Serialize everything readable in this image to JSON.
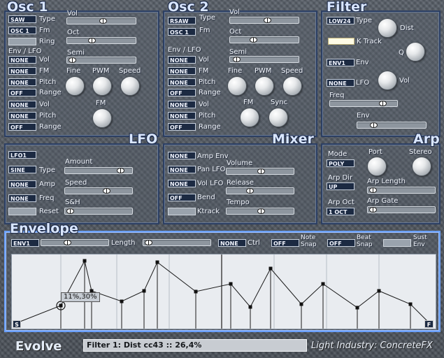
{
  "osc1": {
    "title": "Osc 1",
    "type_btn": "SAW",
    "type_lbl": "Type",
    "fm_btn": "OSC 1",
    "fm_lbl": "Fm",
    "ring_lbl": "Ring",
    "vol_lbl": "Vol",
    "oct_lbl": "Oct",
    "semi_lbl": "Semi",
    "env_lfo_lbl": "Env / LFO",
    "routes": [
      {
        "btn": "NONE",
        "lbl": "Vol"
      },
      {
        "btn": "NONE",
        "lbl": "FM"
      },
      {
        "btn": "NONE",
        "lbl": "Pitch"
      },
      {
        "btn": "OFF",
        "lbl": "Range"
      },
      {
        "btn": "NONE",
        "lbl": "Vol"
      },
      {
        "btn": "NONE",
        "lbl": "Pitch"
      },
      {
        "btn": "OFF",
        "lbl": "Range"
      }
    ],
    "fine": "Fine",
    "pwm": "PWM",
    "speed": "Speed",
    "fm": "FM"
  },
  "osc2": {
    "title": "Osc 2",
    "type_btn": "RSAW",
    "type_lbl": "Type",
    "fm_btn": "OSC 1",
    "fm_lbl": "Fm",
    "vol_lbl": "Vol",
    "oct_lbl": "Oct",
    "semi_lbl": "Semi",
    "env_lfo_lbl": "Env / LFO",
    "routes": [
      {
        "btn": "NONE",
        "lbl": "Vol"
      },
      {
        "btn": "NONE",
        "lbl": "FM"
      },
      {
        "btn": "NONE",
        "lbl": "Pitch"
      },
      {
        "btn": "OFF",
        "lbl": "Range"
      },
      {
        "btn": "NONE",
        "lbl": "Vol"
      },
      {
        "btn": "NONE",
        "lbl": "Pitch"
      },
      {
        "btn": "OFF",
        "lbl": "Range"
      }
    ],
    "fine": "Fine",
    "pwm": "PWM",
    "speed": "Speed",
    "fm": "FM",
    "sync": "Sync"
  },
  "filter": {
    "title": "Filter",
    "type_btn": "LOW24",
    "type_lbl": "Type",
    "dist": "Dist",
    "ktrack": "K Track",
    "q": "Q",
    "env_btn": "ENV1",
    "env_lbl": "Env",
    "lfo_btn": "NONE",
    "lfo_lbl": "LFO",
    "vol": "Vol",
    "freq": "Freq",
    "env2": "Env"
  },
  "lfo": {
    "title": "LFO",
    "sel_btn": "LFO1",
    "type_btn": "SINE",
    "type_lbl": "Type",
    "amp_btn": "NONE",
    "amp_lbl": "Amp",
    "freq_btn": "NONE",
    "freq_lbl": "Freq",
    "reset_lbl": "Reset",
    "amount": "Amount",
    "speed": "Speed",
    "sh": "S&H"
  },
  "mixer": {
    "title": "Mixer",
    "amp_btn": "NONE",
    "amp_lbl": "Amp Env",
    "pan_btn": "NONE",
    "pan_lbl": "Pan LFO",
    "vol_btn": "NONE",
    "vol_lbl": "Vol LFO",
    "bend_btn": "OFF",
    "bend_lbl": "Bend",
    "ktrack_lbl": "Ktrack",
    "volume": "Volume",
    "release": "Release",
    "tempo": "Tempo"
  },
  "arp": {
    "title": "Arp",
    "mode_lbl": "Mode",
    "mode_btn": "POLY",
    "port": "Port",
    "stereo": "Stereo",
    "dir_lbl": "Arp Dir",
    "dir_btn": "UP",
    "length": "Arp Length",
    "oct_lbl": "Arp Oct",
    "oct_btn": "1 OCT",
    "gate": "Arp Gate"
  },
  "envelope": {
    "title": "Envelope",
    "sel_btn": "ENV1",
    "length_lbl": "Length",
    "ctrl_btn": "NONE",
    "ctrl_lbl": "Ctrl",
    "note_btn": "OFF",
    "note_lbl1": "Note",
    "note_lbl2": "Snap",
    "beat_btn": "OFF",
    "beat_lbl1": "Beat",
    "beat_lbl2": "Snap",
    "sust_lbl1": "Sust",
    "sust_lbl2": "Env",
    "tooltip": "11%,30%",
    "start_marker": "S",
    "end_marker": "F"
  },
  "footer": {
    "logo": "Evolve",
    "status": "Filter 1: Dist cc43  :: 26,4%",
    "brand": "Light Industry: ConcreteFX"
  }
}
